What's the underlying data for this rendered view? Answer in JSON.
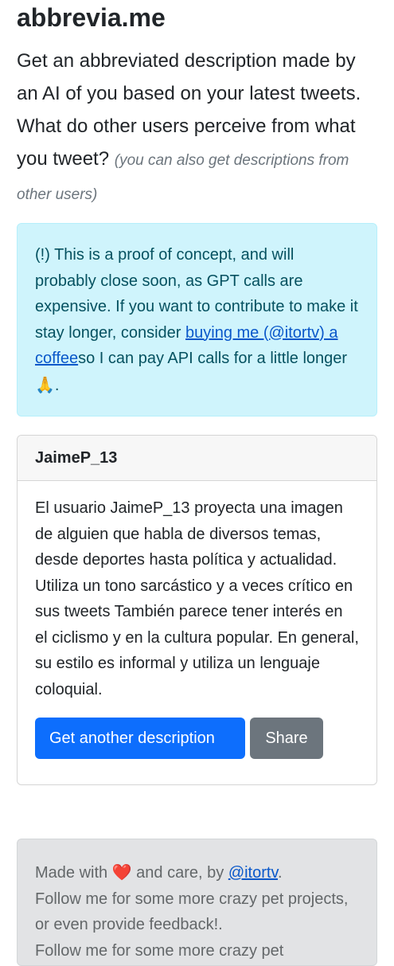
{
  "header": {
    "title": "abbrevia.me",
    "lead": "Get an abbreviated description made by an AI of you based on your latest tweets. What do other users perceive from what you tweet?",
    "lead_note": "(you can also get descriptions from other users)"
  },
  "alert": {
    "text_before": "(!) This is a proof of concept, and will probably close soon, as GPT calls are expensive. If you want to contribute to make it stay longer, consider ",
    "link_text": "buying me (@itortv) a coffee",
    "text_after": "so I can pay API calls for a little longer ",
    "emoji": "🙏",
    "text_end": "."
  },
  "card": {
    "username": "JaimeP_13",
    "description": "El usuario JaimeP_13 proyecta una imagen de alguien que habla de diversos temas, desde deportes hasta política y actualidad. Utiliza un tono sarcástico y a veces crítico en sus tweets También parece tener interés en el ciclismo y en la cultura popular. En general, su estilo es informal y utiliza un lenguaje coloquial.",
    "primary_button": "Get another description",
    "secondary_button": "Share"
  },
  "footer": {
    "made_with": "Made with ",
    "heart": "❤️",
    "and_care": " and care, by ",
    "author_link": "@itortv",
    "period": ".",
    "line2": "Follow me for some more crazy pet projects, or even provide feedback!.",
    "line3": "Follow me for some more crazy pet"
  },
  "colors": {
    "primary": "#0d6efd",
    "secondary": "#6c757d",
    "alert_bg": "#cff4fc",
    "alert_text": "#055160",
    "footer_bg": "#e2e3e5"
  }
}
